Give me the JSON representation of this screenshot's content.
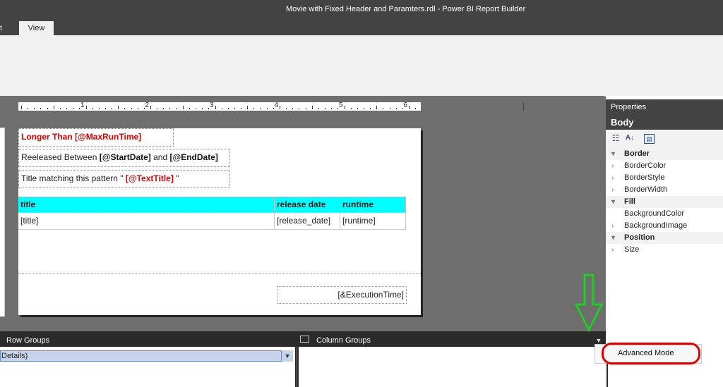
{
  "window": {
    "title": "Movie with Fixed Header and Paramters.rdl - Power BI Report Builder"
  },
  "ribbon": {
    "tabs": [
      {
        "label": "t"
      },
      {
        "label": "View"
      }
    ]
  },
  "ruler": {
    "numbers": [
      "1",
      "2",
      "3",
      "4",
      "5",
      "6"
    ]
  },
  "report": {
    "line1": {
      "prefix": "Longer Than ",
      "param": "[@MaxRunTime]"
    },
    "line2": {
      "prefix": "Reeleased Between ",
      "param1": "[@StartDate]",
      "mid": " and ",
      "param2": "[@EndDate]"
    },
    "line3": {
      "prefix": "Title matching this pattern \" ",
      "param": "[@TextTitle]",
      "suffix": " \""
    },
    "table": {
      "headers": [
        "title",
        "release date",
        "runtime"
      ],
      "row": [
        "[title]",
        "[release_date]",
        "[runtime]"
      ],
      "header_color": "#00ffff"
    },
    "footer_exec": "[&ExecutionTime]"
  },
  "properties": {
    "title": "Properties",
    "object": "Body",
    "tools": [
      {
        "icon": "categorized-icon"
      },
      {
        "icon": "sort-az-icon"
      },
      {
        "icon": "property-pages-icon"
      }
    ],
    "rows": [
      {
        "label": "Border",
        "kind": "category",
        "arrow": "▾"
      },
      {
        "label": "BorderColor",
        "kind": "item",
        "arrow": "›"
      },
      {
        "label": "BorderStyle",
        "kind": "item",
        "arrow": "›"
      },
      {
        "label": "BorderWidth",
        "kind": "item",
        "arrow": "›"
      },
      {
        "label": "Fill",
        "kind": "category",
        "arrow": "▾"
      },
      {
        "label": "BackgroundColor",
        "kind": "item",
        "arrow": ""
      },
      {
        "label": "BackgroundImage",
        "kind": "item",
        "arrow": "›"
      },
      {
        "label": "Position",
        "kind": "category",
        "arrow": "▾"
      },
      {
        "label": "Size",
        "kind": "item",
        "arrow": "›"
      }
    ]
  },
  "groups": {
    "row_label": "Row Groups",
    "column_label": "Column Groups",
    "row_item": "Details)",
    "advanced_mode": "Advanced Mode"
  },
  "annotation": {
    "arrow_color": "#22cc22",
    "circle_color": "#e00000"
  }
}
